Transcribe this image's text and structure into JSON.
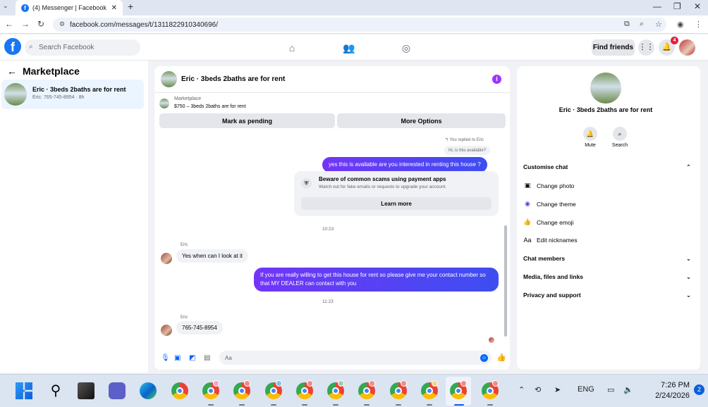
{
  "browser": {
    "tab_title": "(4) Messenger | Facebook",
    "url": "facebook.com/messages/t/1311822910340696/"
  },
  "fb_header": {
    "search_placeholder": "Search Facebook",
    "find_friends": "Find friends",
    "notification_count": "4"
  },
  "sidebar": {
    "title": "Marketplace",
    "conversations": [
      {
        "name": "Eric · 3beds 2baths are for rent",
        "preview": "Eric: 765-745-8954 · 8h"
      }
    ]
  },
  "chat": {
    "title": "Eric · 3beds 2baths are for rent",
    "marketplace_label": "Marketplace",
    "listing": "$750 – 3beds 2baths are for rent",
    "mark_pending": "Mark as pending",
    "more_options": "More Options",
    "replied_note": "You replied to Eric",
    "quoted_message": "Hi, is this available?",
    "messages": [
      {
        "from": "me",
        "text": "yes this is available are you interested in renting this house ?"
      },
      {
        "from": "eric",
        "sender": "Eric",
        "text": "Yes when can I look at it"
      },
      {
        "from": "me",
        "text": "If you are really willing to get this house for rent so please give me your contact number so that MY DEALER can contact with you"
      },
      {
        "from": "eric",
        "sender": "Eric",
        "text": "765-745-8954"
      }
    ],
    "scam_title": "Beware of common scams using payment apps",
    "scam_subtitle": "Watch out for fake emails or requests to upgrade your account.",
    "learn_more": "Learn more",
    "time1": "10:23",
    "time2": "11:23",
    "composer_placeholder": "Aa"
  },
  "details": {
    "name": "Eric · 3beds 2baths are for rent",
    "mute": "Mute",
    "search": "Search",
    "customise_chat": "Customise chat",
    "change_photo": "Change photo",
    "change_theme": "Change theme",
    "change_emoji": "Change emoji",
    "edit_nicknames": "Edit nicknames",
    "chat_members": "Chat members",
    "media_files_links": "Media, files and links",
    "privacy_support": "Privacy and support"
  },
  "taskbar": {
    "language": "ENG",
    "time": "7:26 PM",
    "date": "2/24/2026",
    "notifications": "2"
  },
  "colors": {
    "fb_blue": "#1877f2",
    "outgoing_bubble": "#4846f3",
    "selected_conv": "#ebf5ff",
    "info_purple": "#a033ff"
  }
}
